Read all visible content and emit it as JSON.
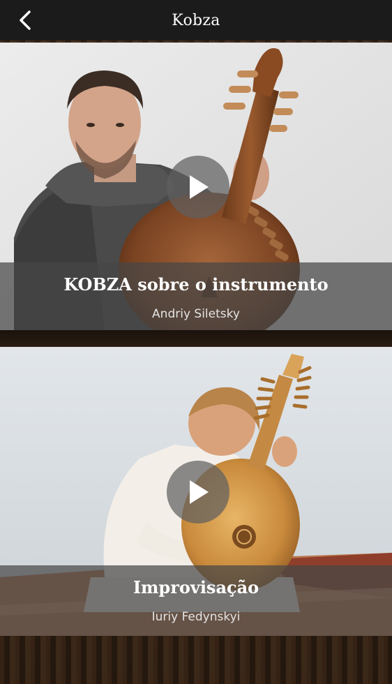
{
  "header": {
    "title": "Kobza",
    "back_icon": "chevron-left-icon"
  },
  "videos": [
    {
      "title": "KOBZA sobre o instrumento",
      "author": "Andriy Siletsky",
      "play_icon": "play-icon"
    },
    {
      "title": "Improvisação",
      "author": "Iuriy Fedynskyi",
      "play_icon": "play-icon"
    }
  ],
  "colors": {
    "nav_bg": "#1b1b1b",
    "caption_bg": "#464646",
    "text": "#ffffff"
  }
}
